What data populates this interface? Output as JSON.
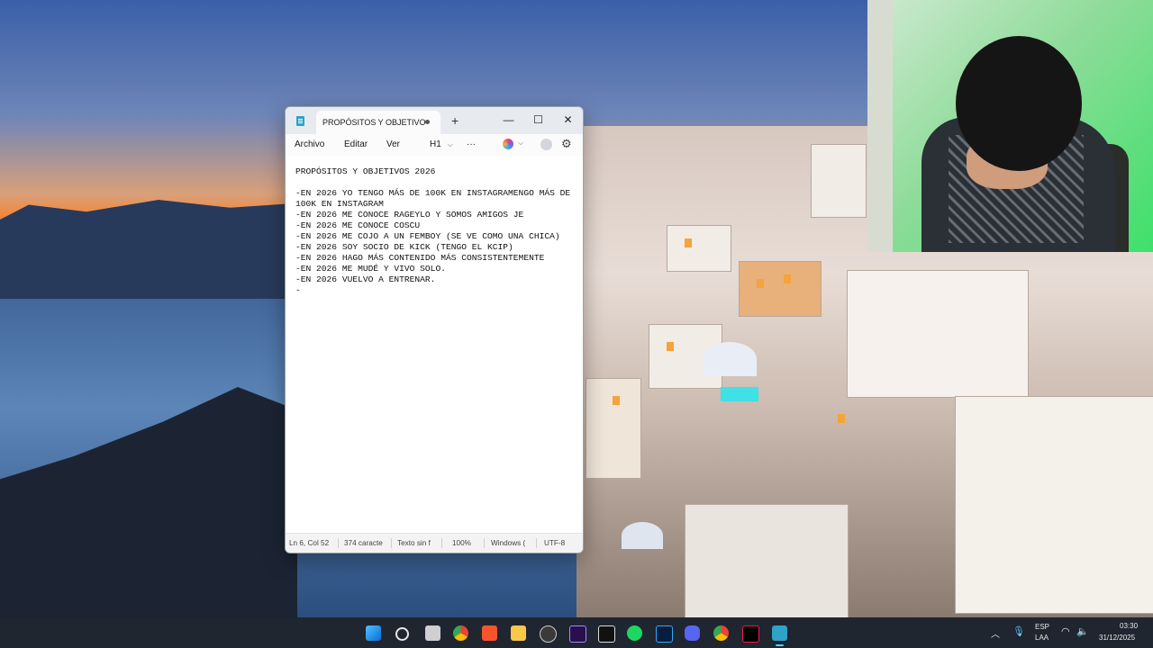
{
  "window": {
    "tab_title": "PROPÓSITOS Y OBJETIVO",
    "new_tab_glyph": "+",
    "minimize_glyph": "—",
    "maximize_glyph": "☐",
    "close_glyph": "✕"
  },
  "menu": {
    "archivo": "Archivo",
    "editar": "Editar",
    "ver": "Ver",
    "heading": "H1",
    "more": "···"
  },
  "document": {
    "lines": [
      "PROPÓSITOS Y OBJETIVOS 2026",
      "",
      "-EN 2026 YO TENGO MÁS DE 100K EN INSTAGRAMENGO MÁS DE",
      "100K EN INSTAGRAM",
      "-EN 2026 ME CONOCE RAGEYLO Y SOMOS AMIGOS JE",
      "-EN 2026 ME CONOCE COSCU",
      "-EN 2026 ME COJO A UN FEMBOY (SE VE COMO UNA CHICA)",
      "-EN 2026 SOY SOCIO DE KICK (TENGO EL KCIP)",
      "-EN 2026 HAGO MÁS CONTENIDO MÁS CONSISTENTEMENTE",
      "-EN 2026 ME MUDÉ Y VIVO SOLO.",
      "-EN 2026 VUELVO A ENTRENAR.",
      "-"
    ]
  },
  "status": {
    "position": "Ln 6, Col 52",
    "chars": "374 caracte",
    "format": "Texto sin f",
    "zoom": "100%",
    "line_ending": "Windows (",
    "encoding": "UTF-8"
  },
  "taskbar": {
    "icons": [
      "windows-start-icon",
      "search-icon",
      "task-view-icon",
      "chrome-icon",
      "brave-icon",
      "file-explorer-icon",
      "obs-icon",
      "premiere-icon",
      "capcut-icon",
      "spotify-icon",
      "photoshop-icon",
      "discord-icon",
      "chrome-icon-2",
      "tiktok-icon",
      "notepad-icon"
    ],
    "lang_top": "ESP",
    "lang_bottom": "LAA",
    "time": "03:30",
    "date": "31/12/2025"
  },
  "colors": {
    "accent": "#60cdff",
    "taskbar_bg": "#1f2630"
  }
}
